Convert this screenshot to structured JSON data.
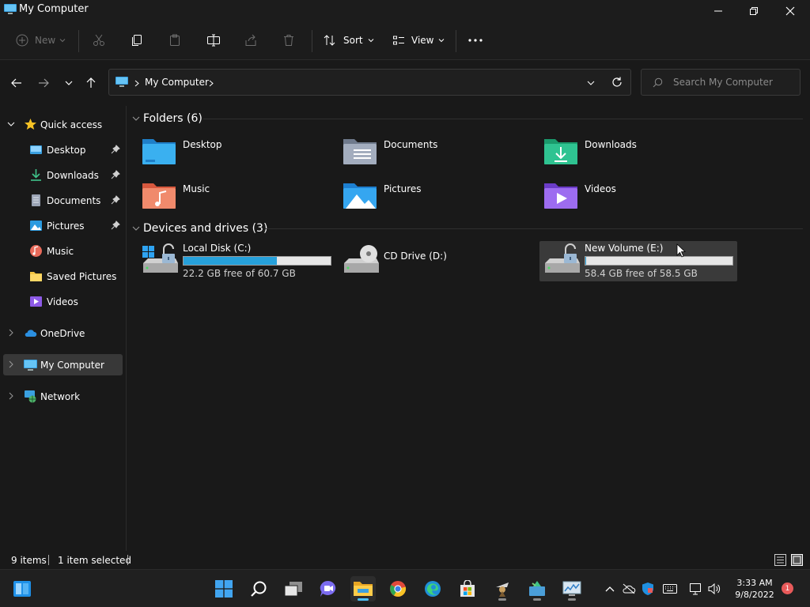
{
  "window": {
    "title": "My Computer"
  },
  "toolbar": {
    "new_label": "New",
    "sort_label": "Sort",
    "view_label": "View"
  },
  "address": {
    "path": "My Computer",
    "search_placeholder": "Search My Computer"
  },
  "sidebar": {
    "quick_access": "Quick access",
    "items": [
      {
        "label": "Desktop",
        "pinned": true
      },
      {
        "label": "Downloads",
        "pinned": true
      },
      {
        "label": "Documents",
        "pinned": true
      },
      {
        "label": "Pictures",
        "pinned": true
      },
      {
        "label": "Music",
        "pinned": false
      },
      {
        "label": "Saved Pictures",
        "pinned": false
      },
      {
        "label": "Videos",
        "pinned": false
      }
    ],
    "onedrive": "OneDrive",
    "my_computer": "My Computer",
    "network": "Network"
  },
  "content": {
    "folders_header": "Folders (6)",
    "folders": [
      {
        "name": "Desktop"
      },
      {
        "name": "Documents"
      },
      {
        "name": "Downloads"
      },
      {
        "name": "Music"
      },
      {
        "name": "Pictures"
      },
      {
        "name": "Videos"
      }
    ],
    "drives_header": "Devices and drives (3)",
    "drives": [
      {
        "name": "Local Disk (C:)",
        "free": "22.2 GB free of 60.7 GB",
        "used_fraction": 0.634
      },
      {
        "name": "CD Drive (D:)"
      },
      {
        "name": "New Volume (E:)",
        "free": "58.4 GB free of 58.5 GB",
        "used_fraction": 0.002
      }
    ]
  },
  "status": {
    "items": "9 items",
    "selected": "1 item selected"
  },
  "taskbar": {
    "time": "3:33 AM",
    "date": "9/8/2022",
    "notifications": "1"
  },
  "colors": {
    "accent": "#26a0da",
    "selected_bg": "#383838",
    "background": "#191919"
  }
}
